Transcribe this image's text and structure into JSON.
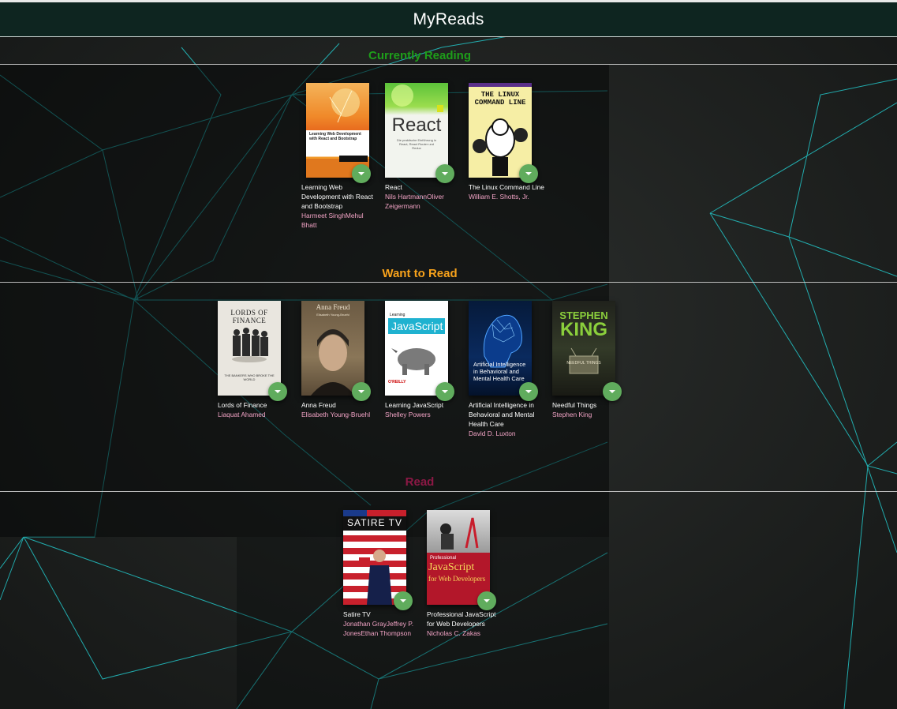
{
  "app": {
    "title": "MyReads"
  },
  "colors": {
    "currently_reading": "#1e9e1a",
    "want_to_read": "#f7a21b",
    "read": "#8c1845",
    "changer": "#60ac5d",
    "author": "#f3a4c6"
  },
  "shelves": [
    {
      "title": "Currently Reading",
      "books": [
        {
          "title": "Learning Web Development with React and Bootstrap",
          "authors": "Harmeet SinghMehul Bhatt",
          "cover_lines": [
            "Learning Web Development",
            "with React and Bootstrap"
          ]
        },
        {
          "title": "React",
          "authors": "Nils HartmannOliver Zeigermann",
          "cover_lines": [
            "React",
            "Die praktische Einführung in React, React Router und Redux"
          ]
        },
        {
          "title": "The Linux Command Line",
          "authors": "William E. Shotts, Jr.",
          "cover_lines": [
            "THE LINUX",
            "COMMAND LINE"
          ]
        }
      ]
    },
    {
      "title": "Want to Read",
      "books": [
        {
          "title": "Lords of Finance",
          "authors": "Liaquat Ahamed",
          "cover_lines": [
            "LORDS OF FINANCE",
            "THE BANKERS WHO BROKE THE WORLD"
          ]
        },
        {
          "title": "Anna Freud",
          "authors": "Elisabeth Young-Bruehl",
          "cover_lines": [
            "Anna Freud",
            "Elisabeth Young-Bruehl"
          ]
        },
        {
          "title": "Learning JavaScript",
          "authors": "Shelley Powers",
          "cover_lines": [
            "Learning",
            "JavaScript",
            "O'REILLY"
          ]
        },
        {
          "title": "Artificial Intelligence in Behavioral and Mental Health Care",
          "authors": "David D. Luxton",
          "cover_lines": [
            "Artificial Intelligence",
            "in Behavioral and",
            "Mental Health Care"
          ]
        },
        {
          "title": "Needful Things",
          "authors": "Stephen King",
          "cover_lines": [
            "STEPHEN",
            "KING",
            "NEEDFUL THINGS"
          ]
        }
      ]
    },
    {
      "title": "Read",
      "books": [
        {
          "title": "Satire TV",
          "authors": "Jonathan GrayJeffrey P. JonesEthan Thompson",
          "cover_lines": [
            "SATIRE TV"
          ]
        },
        {
          "title": "Professional JavaScript for Web Developers",
          "authors": "Nicholas C. Zakas",
          "cover_lines": [
            "Professional",
            "JavaScript",
            "for Web Developers"
          ]
        }
      ]
    }
  ]
}
